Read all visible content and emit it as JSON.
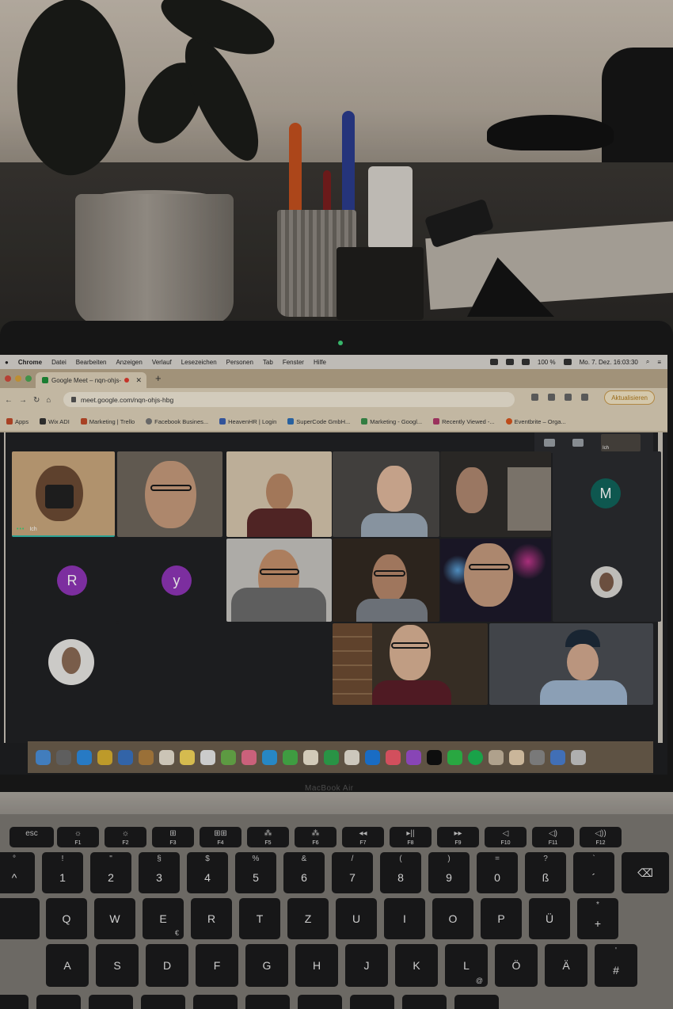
{
  "menubar": {
    "app": "Chrome",
    "items": [
      "Datei",
      "Bearbeiten",
      "Anzeigen",
      "Verlauf",
      "Lesezeichen",
      "Personen",
      "Tab",
      "Fenster",
      "Hilfe"
    ],
    "battery": "100 %",
    "datetime": "Mo. 7. Dez.  16:03:30"
  },
  "browser": {
    "tab_title": "Google Meet – nqn-ohjs-",
    "url": "meet.google.com/nqn-ohjs-hbg",
    "update_label": "Aktualisieren",
    "bookmarks": [
      "Apps",
      "Wix ADI",
      "Marketing | Trello",
      "Facebook Busines...",
      "HeavenHR | Login",
      "SuperCode GmbH...",
      "Marketing - Googl...",
      "Recently Viewed -...",
      "Eventbrite – Orga..."
    ]
  },
  "meet": {
    "self_label": "Ich",
    "self_label_top": "Ich",
    "avatars": [
      {
        "letter": "M",
        "color": "#11635a"
      },
      {
        "letter": "R",
        "color": "#8e35b5"
      },
      {
        "letter": "y",
        "color": "#8e35b5"
      }
    ]
  },
  "laptop": {
    "model": "MacBook Air"
  },
  "keyboard": {
    "fn_row": [
      {
        "top": "esc",
        "label": ""
      },
      {
        "top": "☼",
        "label": "F1"
      },
      {
        "top": "☼",
        "label": "F2"
      },
      {
        "top": "⊞",
        "label": "F3"
      },
      {
        "top": "⊞⊞",
        "label": "F4"
      },
      {
        "top": "⁂",
        "label": "F5"
      },
      {
        "top": "⁂",
        "label": "F6"
      },
      {
        "top": "◂◂",
        "label": "F7"
      },
      {
        "top": "▸||",
        "label": "F8"
      },
      {
        "top": "▸▸",
        "label": "F9"
      },
      {
        "top": "◁",
        "label": "F10"
      },
      {
        "top": "◁)",
        "label": "F11"
      },
      {
        "top": "◁))",
        "label": "F12"
      }
    ],
    "number_row": [
      {
        "main": "^",
        "top": "°"
      },
      {
        "main": "1",
        "top": "!"
      },
      {
        "main": "2",
        "top": "\""
      },
      {
        "main": "3",
        "top": "§"
      },
      {
        "main": "4",
        "top": "$"
      },
      {
        "main": "5",
        "top": "%"
      },
      {
        "main": "6",
        "top": "&"
      },
      {
        "main": "7",
        "top": "/"
      },
      {
        "main": "8",
        "top": "("
      },
      {
        "main": "9",
        "top": ")"
      },
      {
        "main": "0",
        "top": "="
      },
      {
        "main": "ß",
        "top": "?"
      },
      {
        "main": "´",
        "top": "`"
      },
      {
        "main": "⌫",
        "top": ""
      }
    ],
    "top_row": [
      {
        "main": "",
        "sub": ""
      },
      {
        "main": "Q",
        "sub": ""
      },
      {
        "main": "W",
        "sub": ""
      },
      {
        "main": "E",
        "sub": "€"
      },
      {
        "main": "R",
        "sub": ""
      },
      {
        "main": "T",
        "sub": ""
      },
      {
        "main": "Z",
        "sub": ""
      },
      {
        "main": "U",
        "sub": ""
      },
      {
        "main": "I",
        "sub": ""
      },
      {
        "main": "O",
        "sub": ""
      },
      {
        "main": "P",
        "sub": ""
      },
      {
        "main": "Ü",
        "sub": ""
      },
      {
        "main": "+",
        "top": "*"
      }
    ],
    "home_row": [
      {
        "main": "A",
        "sub": ""
      },
      {
        "main": "S",
        "sub": ""
      },
      {
        "main": "D",
        "sub": ""
      },
      {
        "main": "F",
        "sub": ""
      },
      {
        "main": "G",
        "sub": ""
      },
      {
        "main": "H",
        "sub": ""
      },
      {
        "main": "J",
        "sub": ""
      },
      {
        "main": "K",
        "sub": ""
      },
      {
        "main": "L",
        "sub": "@"
      },
      {
        "main": "Ö",
        "sub": ""
      },
      {
        "main": "Ä",
        "sub": ""
      },
      {
        "main": "#",
        "top": "'"
      }
    ]
  }
}
